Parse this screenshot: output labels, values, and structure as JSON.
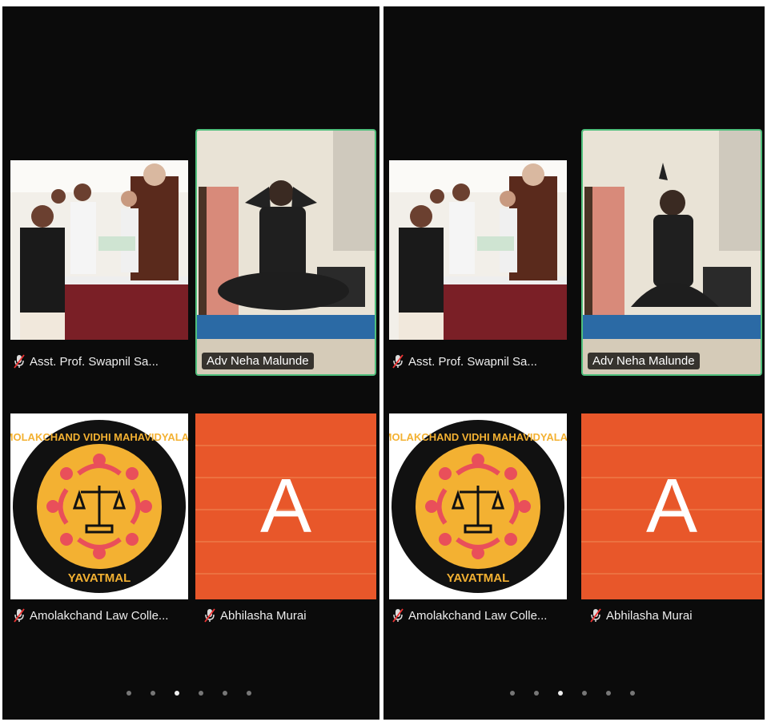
{
  "panels": [
    {
      "tiles": [
        {
          "name": "Asst. Prof. Swapnil Sa...",
          "muted": true
        },
        {
          "name": "Adv Neha Malunde",
          "active_speaker": true
        },
        {
          "name": "Amolakchand Law Colle...",
          "muted": true
        },
        {
          "name": "Abhilasha Murai",
          "muted": true,
          "avatar_letter": "A"
        }
      ],
      "pagination": {
        "total": 6,
        "active_index": 2
      }
    },
    {
      "tiles": [
        {
          "name": "Asst. Prof. Swapnil Sa...",
          "muted": true
        },
        {
          "name": "Adv Neha Malunde",
          "active_speaker": true
        },
        {
          "name": "Amolakchand Law Colle...",
          "muted": true
        },
        {
          "name": "Abhilasha Murai",
          "muted": true,
          "avatar_letter": "A"
        }
      ],
      "pagination": {
        "total": 6,
        "active_index": 2
      }
    }
  ],
  "logo": {
    "top_text": "AMOLAKCHAND VIDHI MAHAVIDYALAYA",
    "bottom_text": "YAVATMAL"
  },
  "colors": {
    "background": "#0b0b0b",
    "active_border": "#4fbf7c",
    "avatar_bg": "#e8572a",
    "logo_ring": "#111111",
    "logo_inner": "#f3b132"
  }
}
